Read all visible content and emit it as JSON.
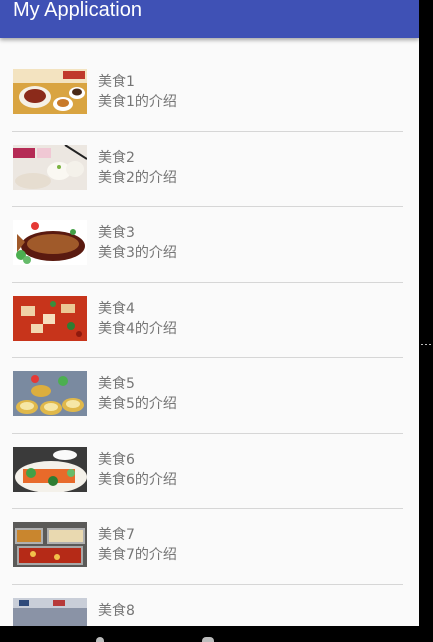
{
  "app": {
    "title": "My Application"
  },
  "colors": {
    "primary": "#3f51b5",
    "text_secondary": "#757575",
    "divider": "#d6d6d6"
  },
  "items": [
    {
      "name": "美食1",
      "desc": "美食1的介绍",
      "image": "food-image-1"
    },
    {
      "name": "美食2",
      "desc": "美食2的介绍",
      "image": "food-image-2"
    },
    {
      "name": "美食3",
      "desc": "美食3的介绍",
      "image": "food-image-3"
    },
    {
      "name": "美食4",
      "desc": "美食4的介绍",
      "image": "food-image-4"
    },
    {
      "name": "美食5",
      "desc": "美食5的介绍",
      "image": "food-image-5"
    },
    {
      "name": "美食6",
      "desc": "美食6的介绍",
      "image": "food-image-6"
    },
    {
      "name": "美食7",
      "desc": "美食7的介绍",
      "image": "food-image-7"
    },
    {
      "name": "美食8",
      "desc": "",
      "image": "food-image-8"
    }
  ]
}
